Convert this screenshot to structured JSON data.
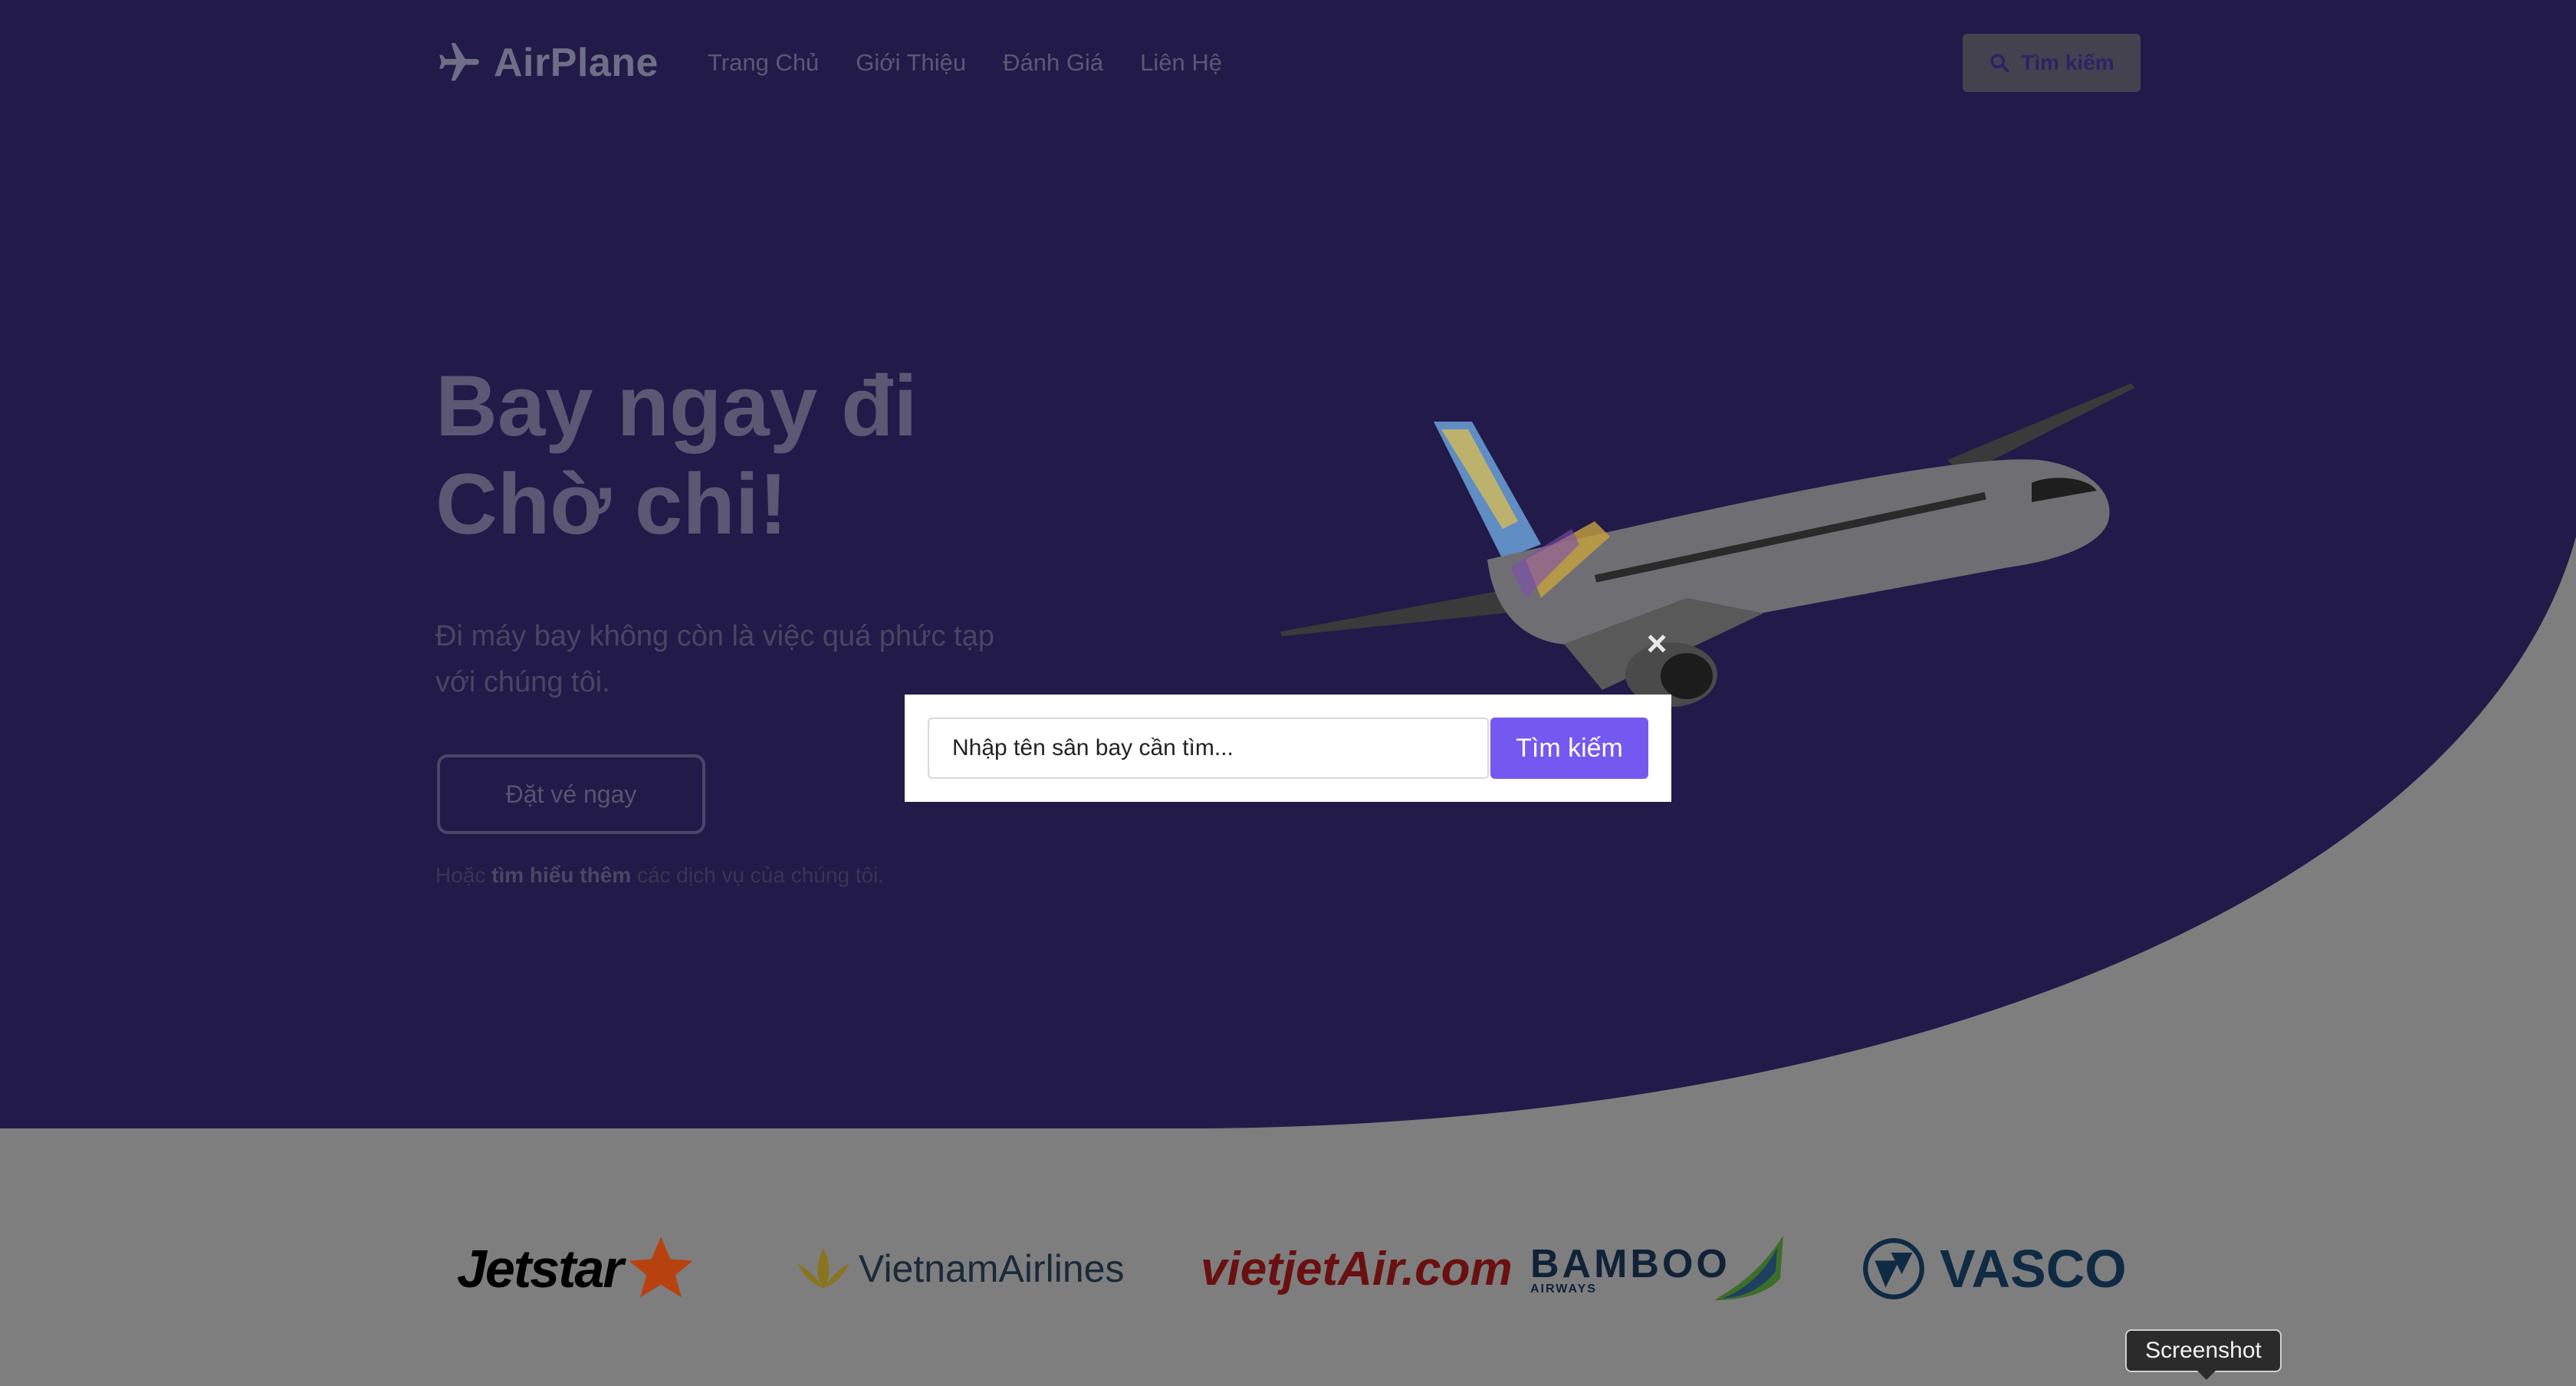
{
  "brand": {
    "name": "AirPlane",
    "icon": "airplane-icon"
  },
  "nav": {
    "links": [
      "Trang Chủ",
      "Giới Thiệu",
      "Đánh Giá",
      "Liên Hệ"
    ],
    "search_label": "Tìm kiếm"
  },
  "hero": {
    "title_line1": "Bay ngay đi",
    "title_line2": "Chờ chi!",
    "lead": "Đi máy bay không còn là việc quá phức tạp với chúng tôi.",
    "book_button": "Đặt vé ngay",
    "small_prefix": "Hoặc",
    "small_link": "tìm hiểu thêm",
    "small_suffix": "các dịch vụ của chúng tôi."
  },
  "logos": [
    "Jetstar",
    "VietnamAirlines",
    "vietjetAir.com",
    "BAMBOO",
    "AIRWAYS",
    "VASCO"
  ],
  "modal": {
    "input_value": "Nhập tên sân bay cần tìm...",
    "button_label": "Tìm kiếm",
    "close_icon": "close-icon"
  },
  "tooltip": "Screenshot",
  "colors": {
    "hero_bg": "#221a48",
    "modal_button": "#7459f0"
  }
}
